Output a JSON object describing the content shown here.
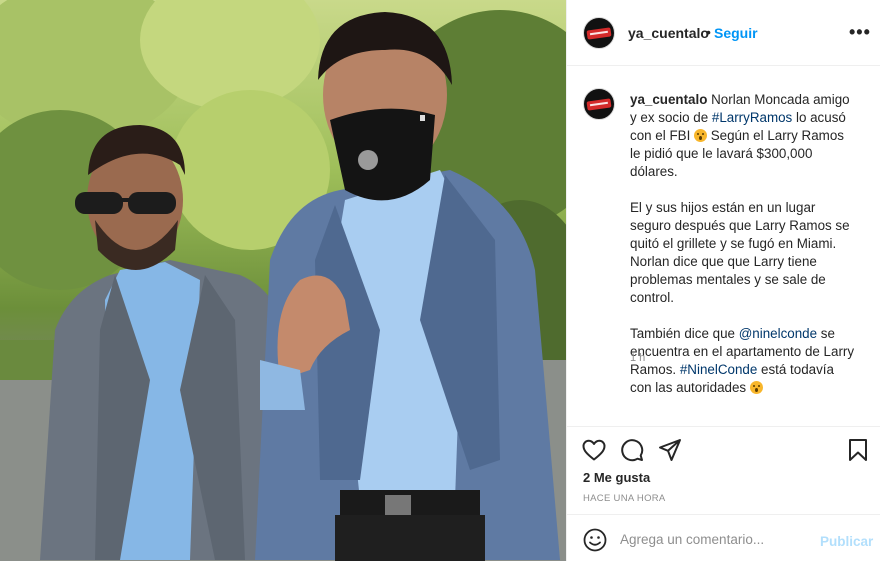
{
  "post": {
    "photo_alt": "",
    "author": {
      "username": "ya_cuentalo",
      "separator": "•",
      "follow_label": "Seguir",
      "more_label": "•••"
    },
    "caption": {
      "username": "ya_cuentalo",
      "p1_a": "Norlan Moncada amigo y ex socio de ",
      "p1_tag": "#LarryRamos",
      "p1_b": " lo acusó con el FBI ",
      "p1_c": " Según el Larry Ramos le pidió que le lavará $300,000 dólares.",
      "p2": "El y sus hijos están en un lugar seguro después que Larry Ramos se quitó el grillete y se fugó en Miami. Norlan dice que que Larry tiene problemas mentales y se sale de control.",
      "p3_a": "También dice que ",
      "p3_mention": "@ninelconde",
      "p3_b": " se encuentra en el apartamento de Larry Ramos. ",
      "p3_tag": "#NinelConde",
      "p3_c": " está todavía con las autoridades ",
      "time": "1 h"
    },
    "likes": "2 Me gusta",
    "posted_ago": "HACE UNA HORA",
    "composer": {
      "placeholder": "Agrega un comentario...",
      "publish_label": "Publicar"
    },
    "icons": [
      "heart-icon",
      "comment-icon",
      "share-icon",
      "bookmark-icon",
      "emoji-icon"
    ],
    "colors": {
      "accent": "#0095f6",
      "link": "#00376b",
      "muted": "#8e8e8e",
      "publish_disabled": "#b2dffc",
      "avatar_brand": "#d42a2a"
    }
  }
}
